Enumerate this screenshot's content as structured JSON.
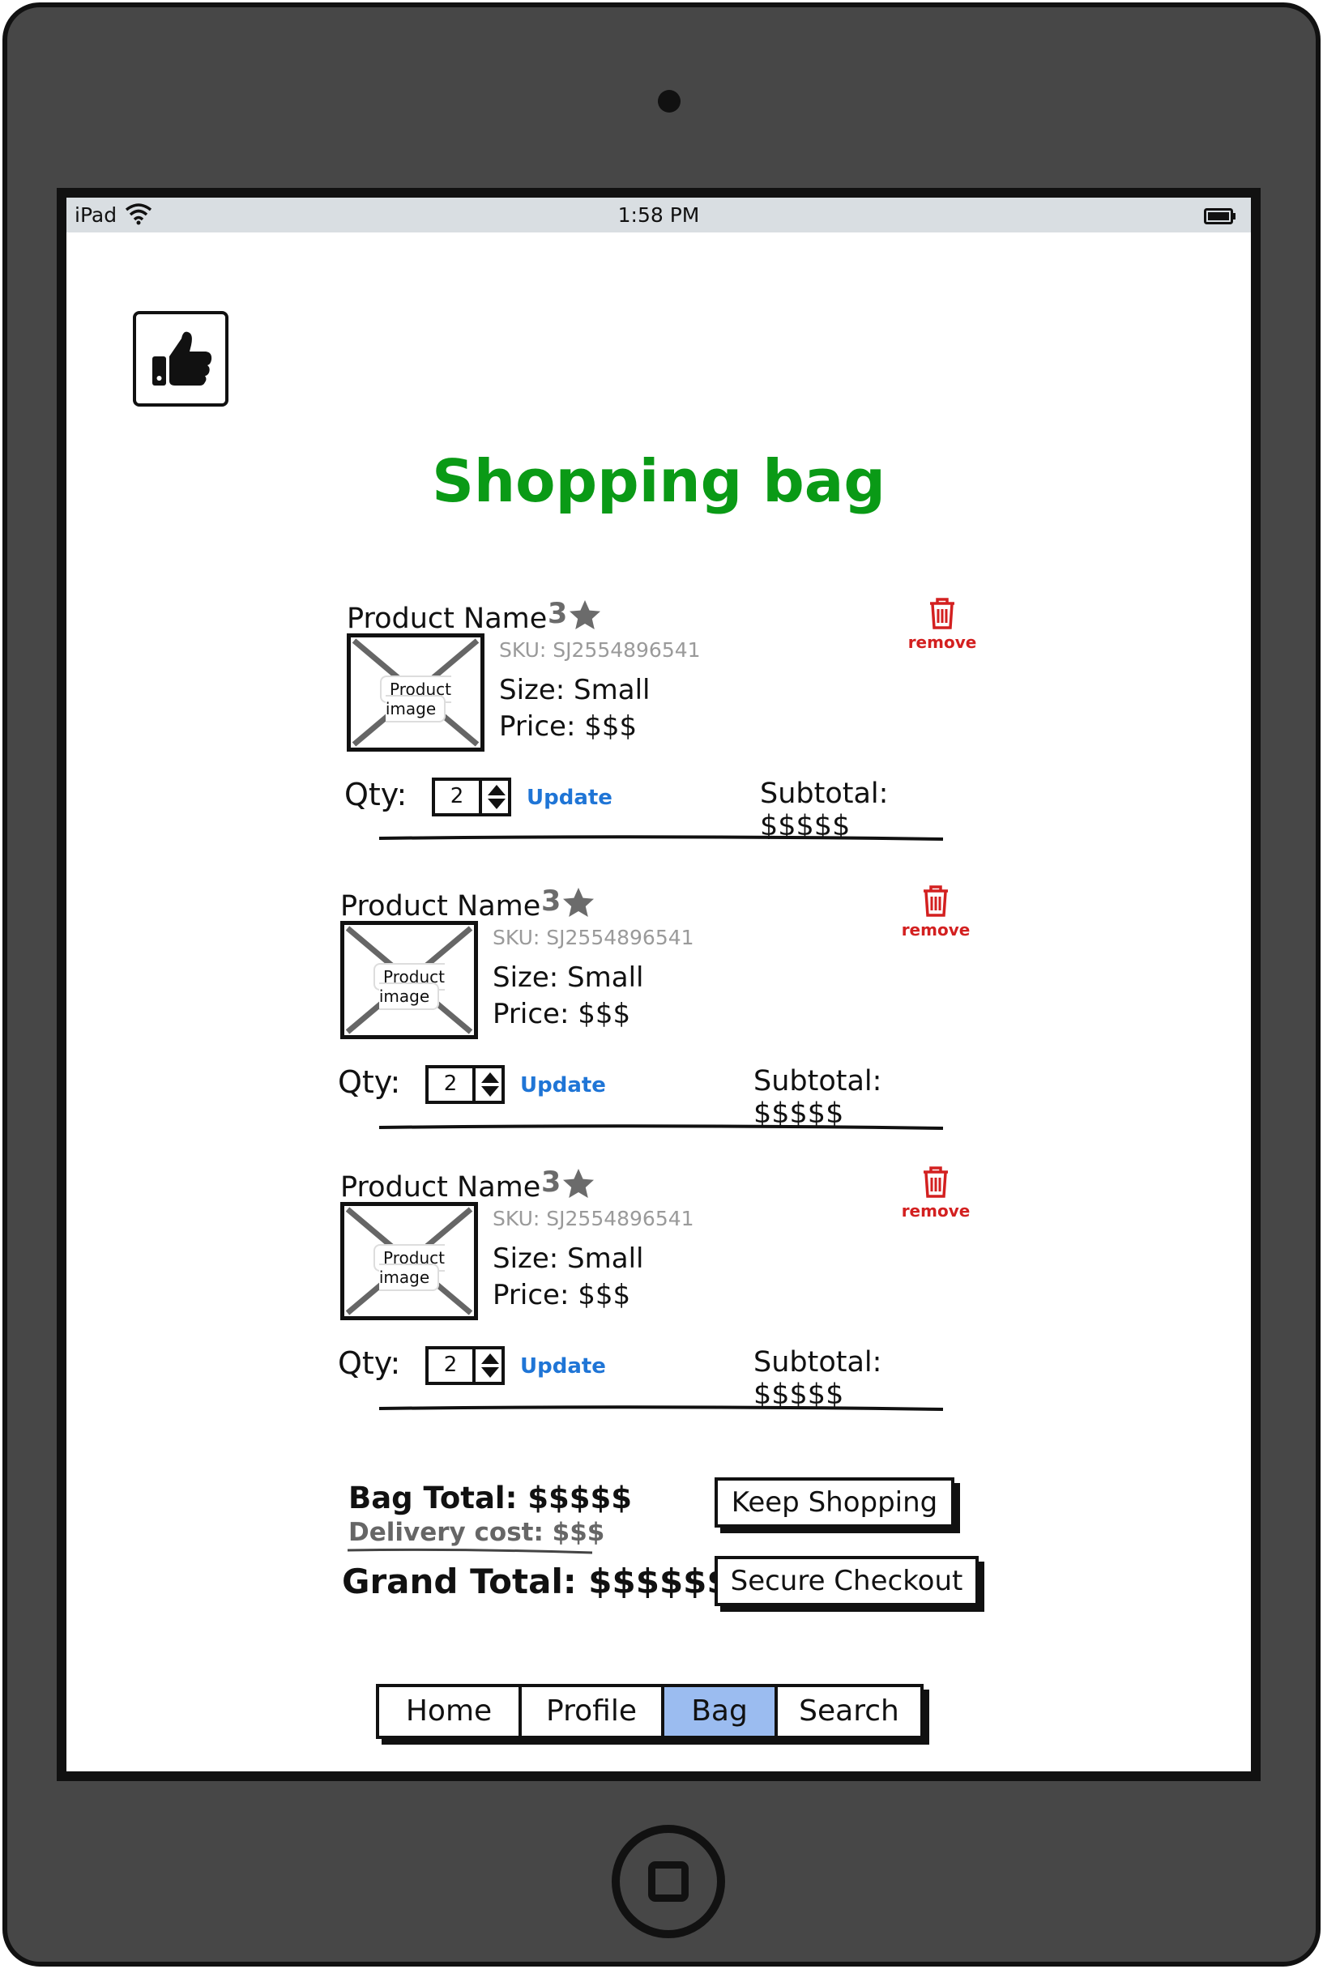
{
  "status_bar": {
    "device": "iPad",
    "time": "1:58 PM"
  },
  "header": {
    "title": "Shopping bag"
  },
  "items": [
    {
      "name": "Product Name",
      "rating": "3",
      "remove_label": "remove",
      "image_label": "Product image",
      "sku": "SKU: SJ2554896541",
      "size": "Size: Small",
      "price": "Price: $$$",
      "qty_label": "Qty:",
      "qty": "2",
      "update_label": "Update",
      "subtotal": "Subtotal: $$$$$"
    },
    {
      "name": "Product Name",
      "rating": "3",
      "remove_label": "remove",
      "image_label": "Product image",
      "sku": "SKU: SJ2554896541",
      "size": "Size: Small",
      "price": "Price: $$$",
      "qty_label": "Qty:",
      "qty": "2",
      "update_label": "Update",
      "subtotal": "Subtotal: $$$$$"
    },
    {
      "name": "Product Name",
      "rating": "3",
      "remove_label": "remove",
      "image_label": "Product image",
      "sku": "SKU: SJ2554896541",
      "size": "Size: Small",
      "price": "Price: $$$",
      "qty_label": "Qty:",
      "qty": "2",
      "update_label": "Update",
      "subtotal": "Subtotal: $$$$$"
    }
  ],
  "summary": {
    "bag_total": "Bag Total: $$$$$",
    "delivery": "Delivery cost: $$$",
    "grand_total": "Grand Total: $$$$$$",
    "keep_shopping": "Keep Shopping",
    "checkout": "Secure Checkout"
  },
  "tabs": [
    {
      "label": "Home",
      "active": false
    },
    {
      "label": "Profile",
      "active": false
    },
    {
      "label": "Bag",
      "active": true
    },
    {
      "label": "Search",
      "active": false
    }
  ],
  "colors": {
    "title": "#0a9a16",
    "remove": "#d32020",
    "link": "#1f75d6",
    "active_tab": "#9bbcf0",
    "device": "#474747"
  },
  "icons": {
    "like": "thumbs-up-icon",
    "remove": "trash-icon",
    "rating": "star-icon",
    "wifi": "wifi-icon",
    "battery": "battery-icon"
  }
}
